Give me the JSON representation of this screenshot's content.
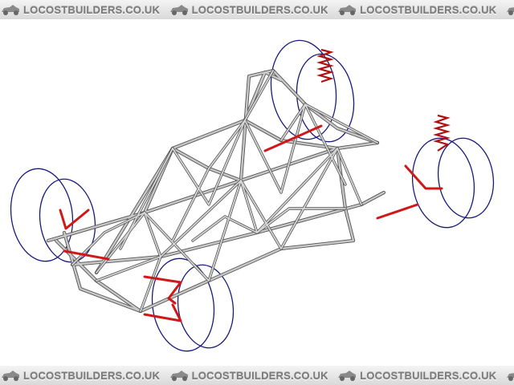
{
  "watermark": {
    "text": "LOCOSTBUILDERS.CO.UK",
    "repeat_count": 5
  },
  "colors": {
    "background": "#ffffff",
    "frame_tube": "#c8c8c8",
    "frame_outline": "#555555",
    "wheel": "#1a1a7a",
    "suspension": "#d01818",
    "coilover_spring": "#b01010",
    "watermark_text": "#7a7a7a"
  },
  "diagram": {
    "subject": "locost-space-frame-chassis",
    "parts": [
      "front-left-wheel",
      "front-right-wheel",
      "rear-left-wheel",
      "rear-right-wheel",
      "front-left-coilover",
      "rear-right-coilover",
      "space-frame",
      "wishbones"
    ]
  }
}
